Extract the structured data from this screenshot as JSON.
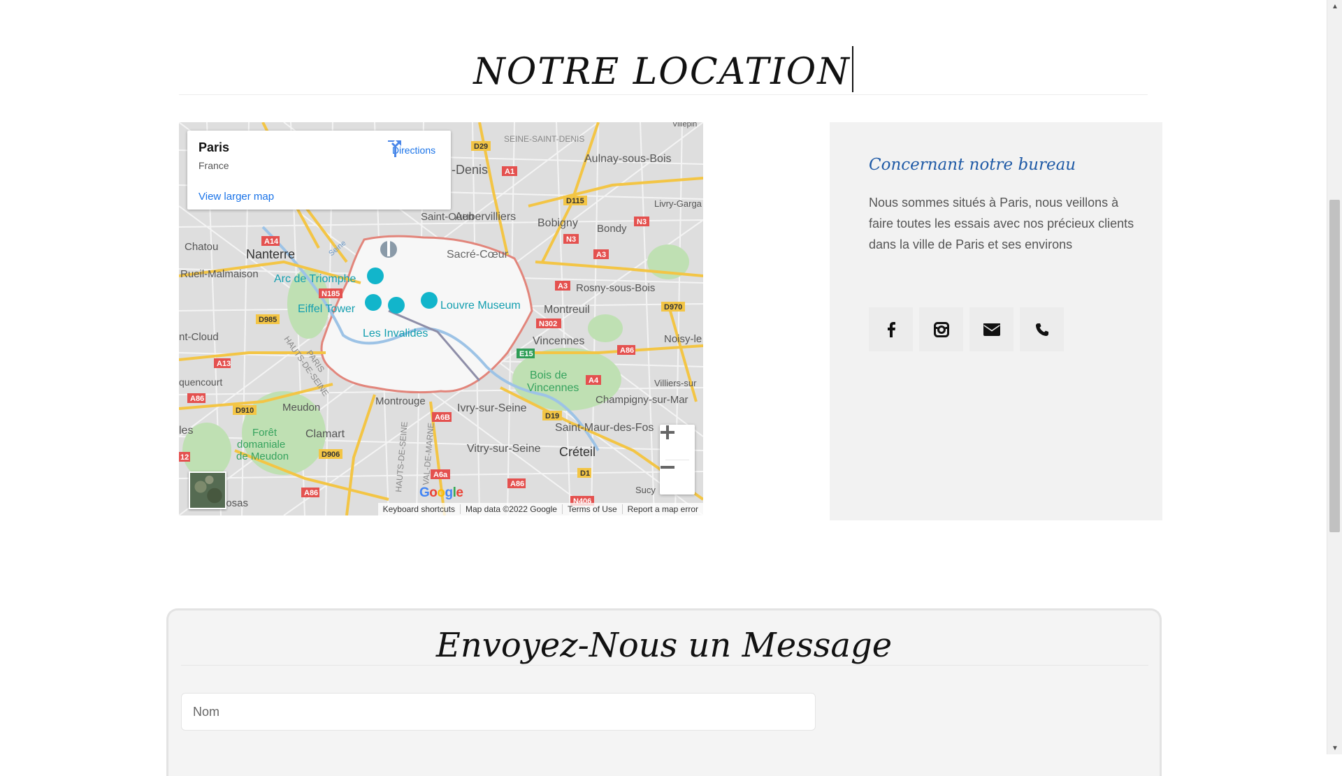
{
  "location": {
    "title": "NOTRE LOCATION"
  },
  "map": {
    "card": {
      "place": "Paris",
      "country": "France",
      "view_larger": "View larger map",
      "directions": "Directions"
    },
    "labels": {
      "saint_denis": "SEINE-SAINT-DENIS",
      "denis": "-Denis",
      "aulnay": "Aulnay-sous-Bois",
      "livry": "Livry-Garga",
      "bobigny": "Bobigny",
      "bondy": "Bondy",
      "saint_ouen": "Saint-Ouen",
      "aubervilliers": "Aubervilliers",
      "chatou": "Chatou",
      "nanterre": "Nanterre",
      "rueil": "Rueil-Malmaison",
      "arc": "Arc de Triomphe",
      "sacre": "Sacré-Cœur",
      "eiffel": "Eiffel Tower",
      "louvre": "Louvre Museum",
      "invalides": "Les Invalides",
      "montreuil": "Montreuil",
      "rosny": "Rosny-sous-Bois",
      "vincennes": "Vincennes",
      "bois": "Bois de",
      "bois2": "Vincennes",
      "noisy": "Noisy-le",
      "villiers": "Villiers-sur",
      "champigny": "Champigny-sur-Mar",
      "cloud": "nt-Cloud",
      "quencourt": "quencourt",
      "meudon": "Meudon",
      "montrouge": "Montrouge",
      "ivry": "Ivry-sur-Seine",
      "saint_maur": "Saint-Maur-des-Fos",
      "clamart": "Clamart",
      "foret1": "Forêt",
      "foret2": "domaniale",
      "foret3": "de Meudon",
      "vitry": "Vitry-sur-Seine",
      "creteil": "Créteil",
      "sucy": "Sucy",
      "les": "les",
      "losas": "losas",
      "villepin": "Villepin",
      "paris_dept": "PARIS",
      "hauts": "HAUTS-DE-SEINE",
      "seine": "Seine",
      "val_marne": "VAL-DE-MARNE",
      "hauts2": "HAUTS-DE-SEINE"
    },
    "roads": [
      "D29",
      "A1",
      "D115",
      "N3",
      "N3",
      "A3",
      "A14",
      "N185",
      "D985",
      "A3",
      "D970",
      "N302",
      "E15",
      "A86",
      "A4",
      "A13",
      "A86",
      "D910",
      "D19",
      "A6B",
      "D906",
      "D1",
      "A6a",
      "A86",
      "N406",
      "A86",
      "12"
    ],
    "google": [
      "G",
      "o",
      "o",
      "g",
      "l",
      "e"
    ],
    "attribution": {
      "shortcuts": "Keyboard shortcuts",
      "data": "Map data ©2022 Google",
      "terms": "Terms of Use",
      "report": "Report a map error"
    }
  },
  "office": {
    "title": "Concernant notre bureau",
    "text": "Nous sommes situés à Paris, nous veillons à faire toutes les essais avec nos précieux clients dans la ville de Paris et ses environs",
    "socials": [
      "facebook-icon",
      "instagram-icon",
      "envelope-icon",
      "phone-icon"
    ]
  },
  "message": {
    "title": "Envoyez-Nous un Message",
    "name_placeholder": "Nom",
    "name_value": ""
  },
  "colors": {
    "accent": "#1f5aa6",
    "panel": "#f2f2f2",
    "map_link": "#1a73e8"
  }
}
